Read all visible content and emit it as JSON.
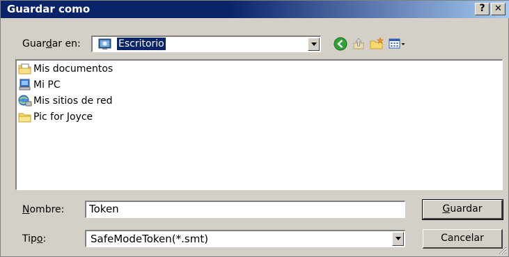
{
  "window": {
    "title": "Guardar como",
    "help_label": "?",
    "close_label": "✕"
  },
  "location": {
    "label_pre": "Guar",
    "label_u": "d",
    "label_post": "ar en:",
    "current_folder": "Escritorio"
  },
  "toolbar": {
    "back_icon": "back-arrow-icon",
    "up_icon": "up-folder-icon",
    "new_folder_icon": "new-folder-icon",
    "view_menu_icon": "view-menu-icon"
  },
  "files": [
    {
      "name": "Mis documentos",
      "icon": "my-documents-icon"
    },
    {
      "name": "Mi PC",
      "icon": "my-computer-icon"
    },
    {
      "name": "Mis sitios de red",
      "icon": "network-places-icon"
    },
    {
      "name": "Pic for Joyce",
      "icon": "folder-icon"
    }
  ],
  "filename": {
    "label_u": "N",
    "label_post": "ombre:",
    "value": "Token"
  },
  "filetype": {
    "label_pre": "Tip",
    "label_u": "o",
    "label_post": ":",
    "value": "SafeModeToken(*.smt)"
  },
  "buttons": {
    "save_u": "G",
    "save_post": "uardar",
    "cancel": "Cancelar"
  }
}
